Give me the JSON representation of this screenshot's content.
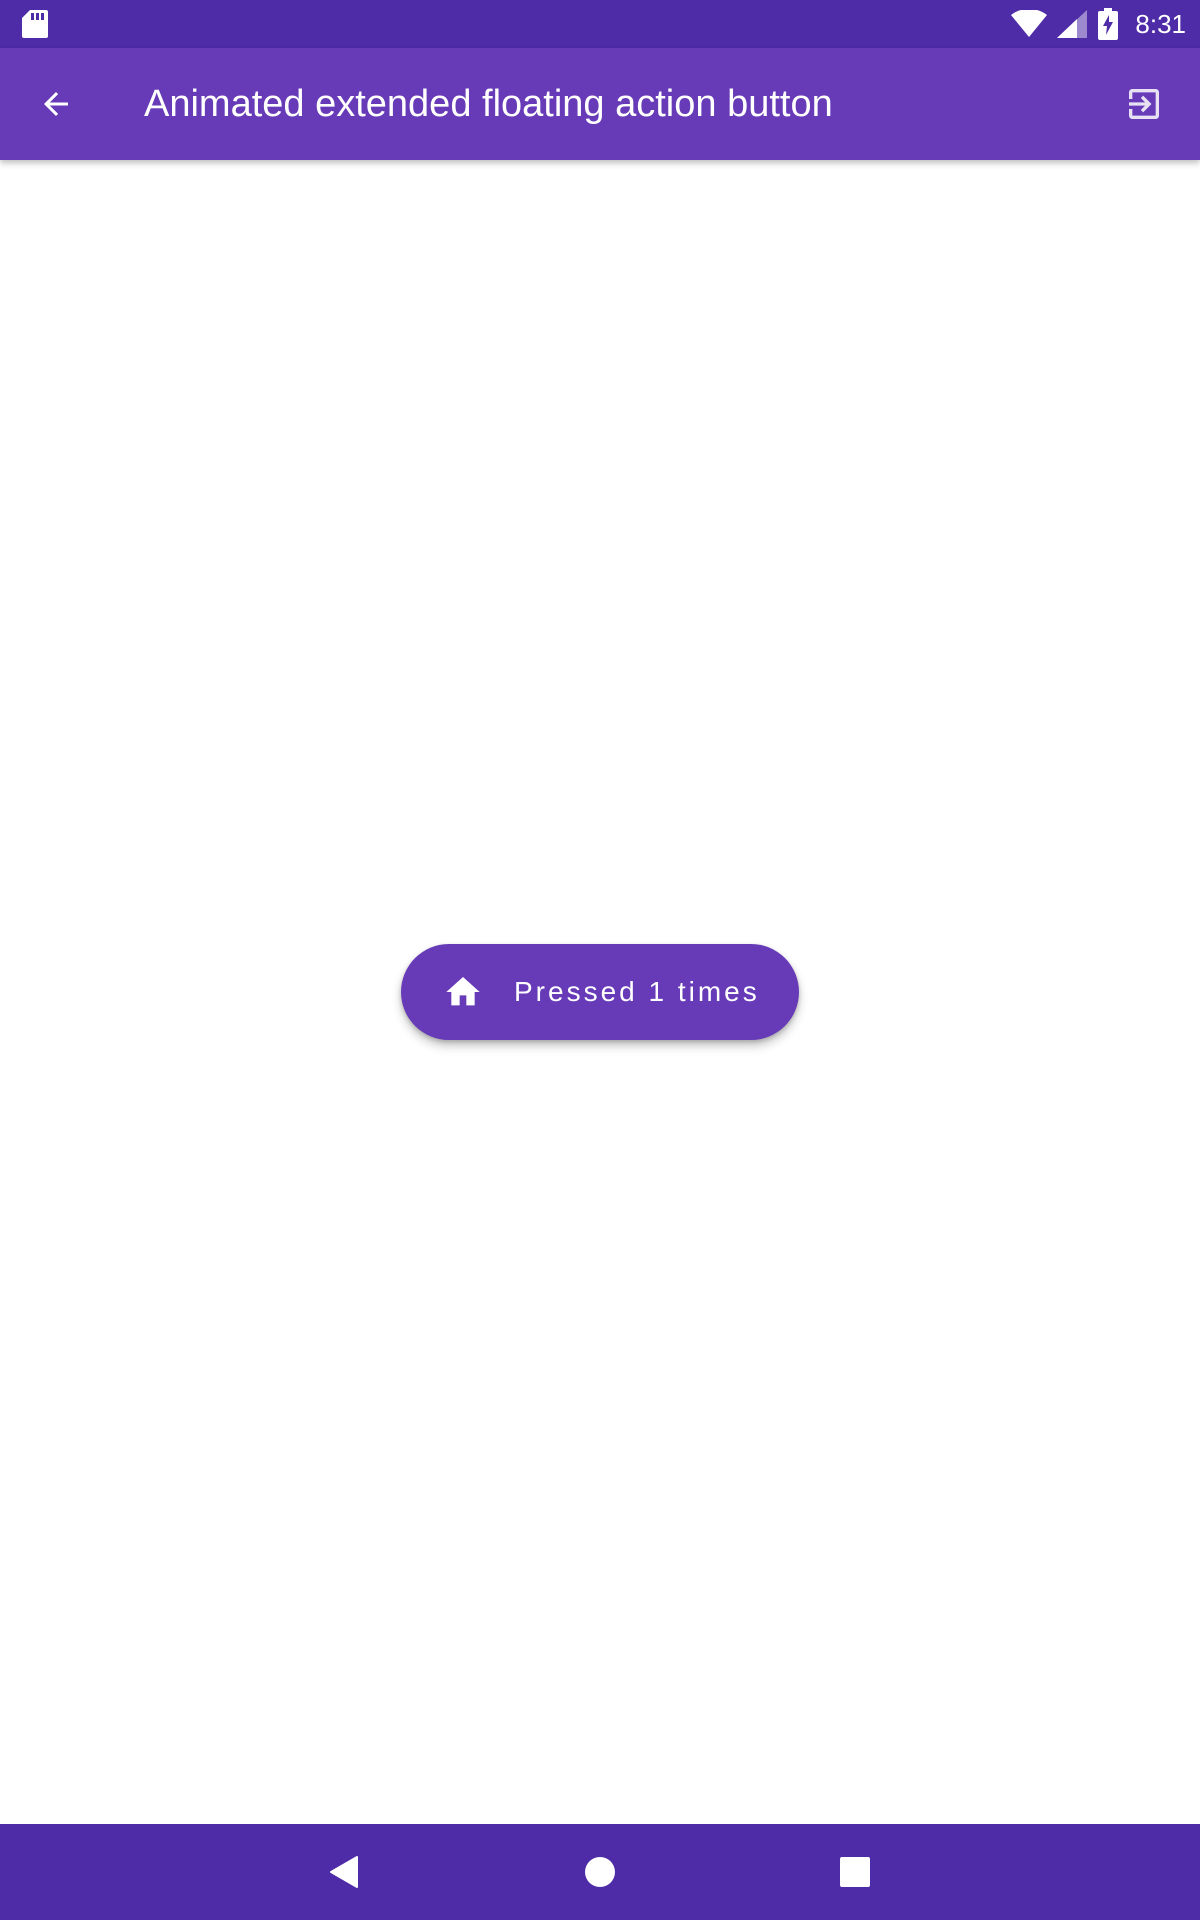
{
  "status_bar": {
    "time": "8:31",
    "icons": [
      "sd-card-icon",
      "wifi-icon",
      "cell-signal-icon",
      "battery-charging-icon"
    ]
  },
  "app_bar": {
    "title": "Animated extended floating action button",
    "back_icon": "arrow-back-icon",
    "exit_icon": "exit-to-app-icon"
  },
  "fab": {
    "icon": "home-icon",
    "label": "Pressed 1 times"
  },
  "nav_bar": {
    "icons": [
      "nav-back-icon",
      "nav-home-icon",
      "nav-recents-icon"
    ]
  },
  "colors": {
    "status_bar": "#4e2ba7",
    "app_bar": "#673ab7",
    "fab": "#673ab7",
    "nav_bar": "#4e2ba7",
    "on_primary": "#ffffff",
    "background": "#ffffff"
  }
}
